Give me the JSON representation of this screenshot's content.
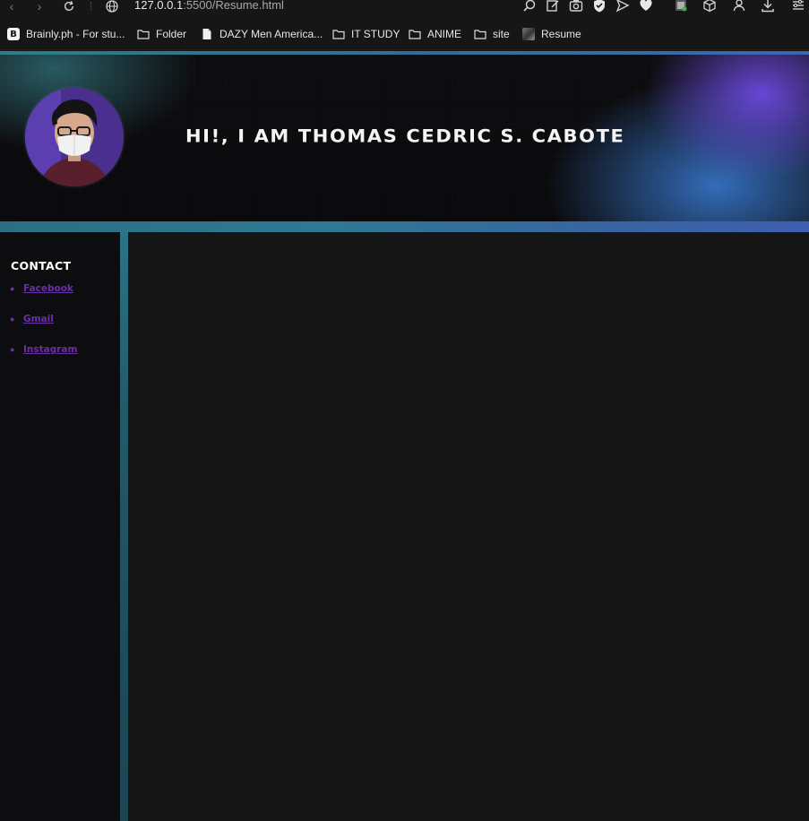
{
  "browser": {
    "url_host": "127.0.0.1",
    "url_rest": ":5500/Resume.html"
  },
  "bookmarks": [
    {
      "label": "Brainly.ph - For stu...",
      "icon": "brainly-icon"
    },
    {
      "label": "Folder",
      "icon": "folder-icon"
    },
    {
      "label": "DAZY Men America...",
      "icon": "document-icon"
    },
    {
      "label": "IT STUDY",
      "icon": "folder-icon"
    },
    {
      "label": "ANIME",
      "icon": "folder-icon"
    },
    {
      "label": "site",
      "icon": "folder-icon"
    },
    {
      "label": "Resume",
      "icon": "resume-thumbnail-icon"
    }
  ],
  "hero": {
    "title": "HI!, I AM THOMAS CEDRIC S. CABOTE"
  },
  "sidebar": {
    "contact_title": "CONTACT",
    "links": [
      {
        "label": "Facebook"
      },
      {
        "label": "Gmail"
      },
      {
        "label": "Instagram"
      }
    ]
  },
  "colors": {
    "accent_teal": "#2b7e8c",
    "accent_purple": "#6c49de",
    "link_color": "#6a2ea9",
    "page_bg": "#161516",
    "sidebar_bg": "#0d0d0f"
  }
}
